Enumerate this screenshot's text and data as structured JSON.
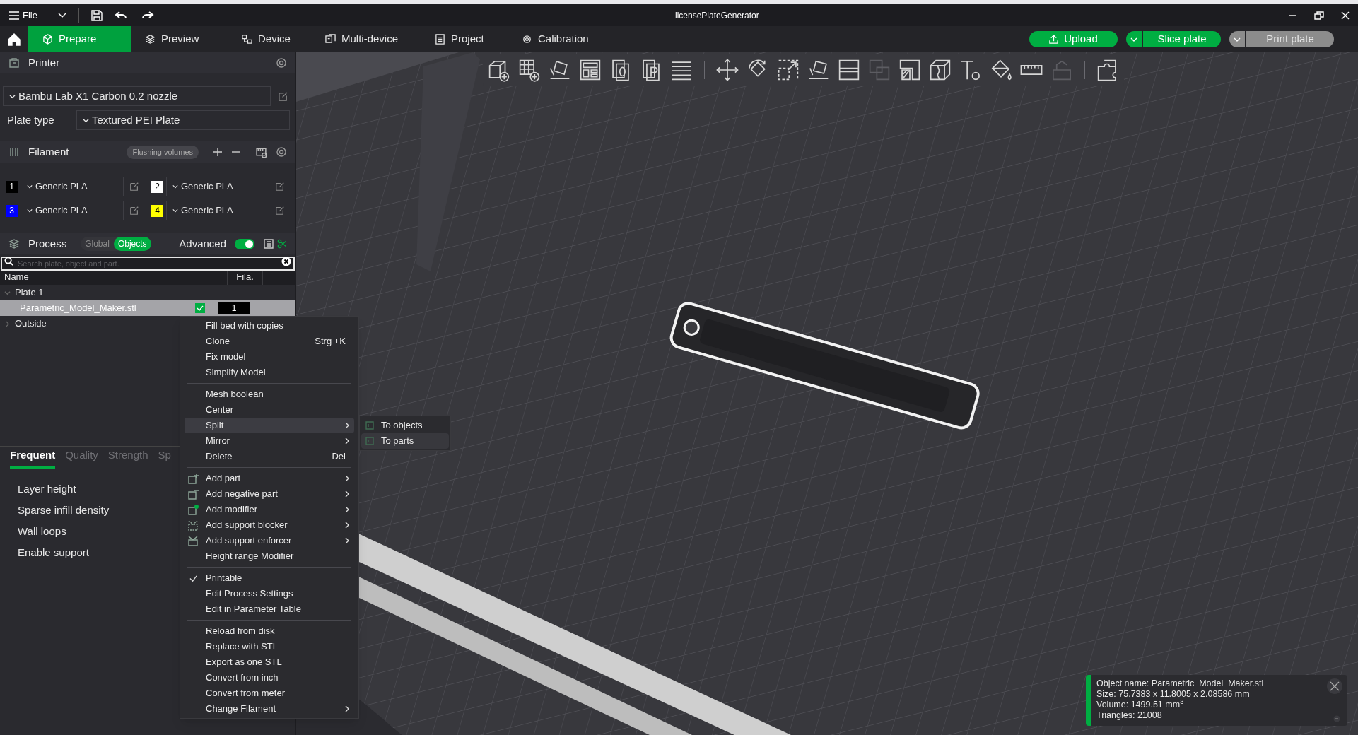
{
  "title_bar": {
    "menu": "File",
    "title": "licensePlateGenerator"
  },
  "tabs": [
    {
      "label": "Prepare",
      "selected": true
    },
    {
      "label": "Preview",
      "selected": false
    },
    {
      "label": "Device",
      "selected": false
    },
    {
      "label": "Multi-device",
      "selected": false
    },
    {
      "label": "Project",
      "selected": false
    },
    {
      "label": "Calibration",
      "selected": false
    }
  ],
  "actions": [
    {
      "label": "Upload",
      "kind": "single",
      "disabled": false
    },
    {
      "label": "Slice plate",
      "kind": "split",
      "disabled": false
    },
    {
      "label": "Print plate",
      "kind": "split",
      "disabled": true
    }
  ],
  "printer": {
    "title": "Printer",
    "preset": "Bambu Lab X1 Carbon 0.2 nozzle",
    "plate_label": "Plate type",
    "plate_type": "Textured PEI Plate"
  },
  "filament": {
    "title": "Filament",
    "button": "Flushing volumes",
    "slots": [
      {
        "number": "1",
        "color": "#000000",
        "name": "Generic PLA"
      },
      {
        "number": "2",
        "color": "#ffffff",
        "name": "Generic PLA"
      },
      {
        "number": "3",
        "color": "#0000ff",
        "name": "Generic PLA"
      },
      {
        "number": "4",
        "color": "#ffff00",
        "name": "Generic PLA"
      }
    ]
  },
  "process": {
    "title": "Process",
    "modes": [
      {
        "label": "Global",
        "selected": false
      },
      {
        "label": "Objects",
        "selected": true
      }
    ],
    "advanced_label": "Advanced",
    "advanced_on": true
  },
  "object_list": {
    "search_placeholder": "Search plate, object and part.",
    "columns": [
      "Name",
      "Fila."
    ],
    "tree": [
      {
        "name": "Plate 1",
        "expanded": true,
        "children": [
          {
            "name": "Parametric_Model_Maker.stl",
            "selected": true,
            "printable": true,
            "filament": "1"
          }
        ]
      },
      {
        "name": "Outside",
        "expanded": false
      }
    ]
  },
  "settings_tabs": [
    {
      "label": "Frequent",
      "selected": true
    },
    {
      "label": "Quality",
      "selected": false
    },
    {
      "label": "Strength",
      "selected": false
    },
    {
      "label": "Sp",
      "selected": false
    }
  ],
  "settings": [
    {
      "label": "Layer height"
    },
    {
      "label": "Sparse infill density"
    },
    {
      "label": "Wall loops"
    },
    {
      "label": "Enable support"
    }
  ],
  "context_menu": [
    [
      {
        "label": "Fill bed with copies",
        "kind": "plain",
        "submenu": false,
        "selected": false,
        "checked": false
      },
      {
        "label": "Clone",
        "shortcut": "Strg +K",
        "kind": "plain",
        "submenu": false,
        "selected": false,
        "checked": false
      },
      {
        "label": "Fix model",
        "kind": "plain",
        "submenu": false,
        "selected": false,
        "checked": false
      },
      {
        "label": "Simplify Model",
        "kind": "plain",
        "submenu": false,
        "selected": false,
        "checked": false
      }
    ],
    [
      {
        "label": "Mesh boolean",
        "kind": "plain",
        "submenu": false,
        "selected": false,
        "checked": false
      },
      {
        "label": "Center",
        "kind": "plain",
        "submenu": false,
        "selected": false,
        "checked": false
      },
      {
        "label": "Split",
        "kind": "plain",
        "submenu": true,
        "selected": true,
        "checked": false
      },
      {
        "label": "Mirror",
        "kind": "plain",
        "submenu": true,
        "selected": false,
        "checked": false
      },
      {
        "label": "Delete",
        "shortcut": "Del",
        "kind": "plain",
        "submenu": false,
        "selected": false,
        "checked": false
      }
    ],
    [
      {
        "label": "Add part",
        "kind": "part",
        "submenu": true,
        "selected": false,
        "checked": false
      },
      {
        "label": "Add negative part",
        "kind": "negative",
        "submenu": true,
        "selected": false,
        "checked": false
      },
      {
        "label": "Add modifier",
        "kind": "modifier",
        "submenu": true,
        "selected": false,
        "checked": false
      },
      {
        "label": "Add support blocker",
        "kind": "blocker",
        "submenu": true,
        "selected": false,
        "checked": false
      },
      {
        "label": "Add support enforcer",
        "kind": "enforcer",
        "submenu": true,
        "selected": false,
        "checked": false
      },
      {
        "label": "Height range Modifier",
        "kind": "plain",
        "submenu": false,
        "selected": false,
        "checked": false
      }
    ],
    [
      {
        "label": "Printable",
        "kind": "plain",
        "submenu": false,
        "selected": false,
        "checked": true
      },
      {
        "label": "Edit Process Settings",
        "kind": "plain",
        "submenu": false,
        "selected": false,
        "checked": false
      },
      {
        "label": "Edit in Parameter Table",
        "kind": "plain",
        "submenu": false,
        "selected": false,
        "checked": false
      }
    ],
    [
      {
        "label": "Reload from disk",
        "kind": "plain",
        "submenu": false,
        "selected": false,
        "checked": false
      },
      {
        "label": "Replace with STL",
        "kind": "plain",
        "submenu": false,
        "selected": false,
        "checked": false
      },
      {
        "label": "Export as one STL",
        "kind": "plain",
        "submenu": false,
        "selected": false,
        "checked": false
      },
      {
        "label": "Convert from inch",
        "kind": "plain",
        "submenu": false,
        "selected": false,
        "checked": false
      },
      {
        "label": "Convert from meter",
        "kind": "plain",
        "submenu": false,
        "selected": false,
        "checked": false
      },
      {
        "label": "Change Filament",
        "kind": "plain",
        "submenu": true,
        "selected": false,
        "checked": false
      }
    ]
  ],
  "submenu": [
    {
      "label": "To objects",
      "selected": false
    },
    {
      "label": "To parts",
      "selected": true
    }
  ],
  "info": {
    "lines": [
      "Object name: Parametric_Model_Maker.stl",
      "Size: 75.7383 x 11.8005 x 2.08586 mm",
      "Volume: 1499.51 mm$^{3}$",
      "Triangles: 21008"
    ]
  }
}
